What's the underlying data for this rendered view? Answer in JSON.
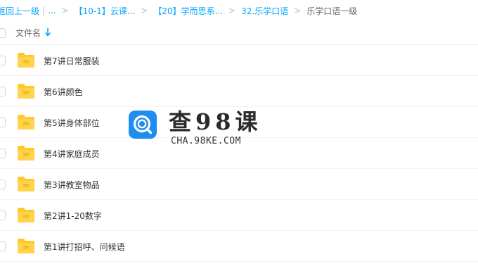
{
  "breadcrumb": {
    "back_label": "返回上一级",
    "divider": "|",
    "ellipsis": "...",
    "items": [
      "【10-1】云课...",
      "【20】学而思系...",
      "32.乐学口语"
    ],
    "current": "乐学口语一级"
  },
  "list_header": {
    "column_label": "文件名",
    "sort_icon": "arrow-down-icon"
  },
  "files": [
    {
      "name": "第7讲日常服装",
      "icon": "folder-icon"
    },
    {
      "name": "第6讲颜色",
      "icon": "folder-icon"
    },
    {
      "name": "第5讲身体部位",
      "icon": "folder-icon"
    },
    {
      "name": "第4讲家庭成员",
      "icon": "folder-icon"
    },
    {
      "name": "第3讲教室物品",
      "icon": "folder-icon"
    },
    {
      "name": "第2讲1-20数字",
      "icon": "folder-icon"
    },
    {
      "name": "第1讲打招呼、问候语",
      "icon": "folder-icon"
    }
  ],
  "watermark": {
    "title": "查98课",
    "subtitle": "CHA.98KE.COM"
  },
  "colors": {
    "link": "#06a7ff",
    "folder": "#ffc928",
    "folder_dark": "#f5b400",
    "watermark_blue": "#1e8cf0"
  }
}
